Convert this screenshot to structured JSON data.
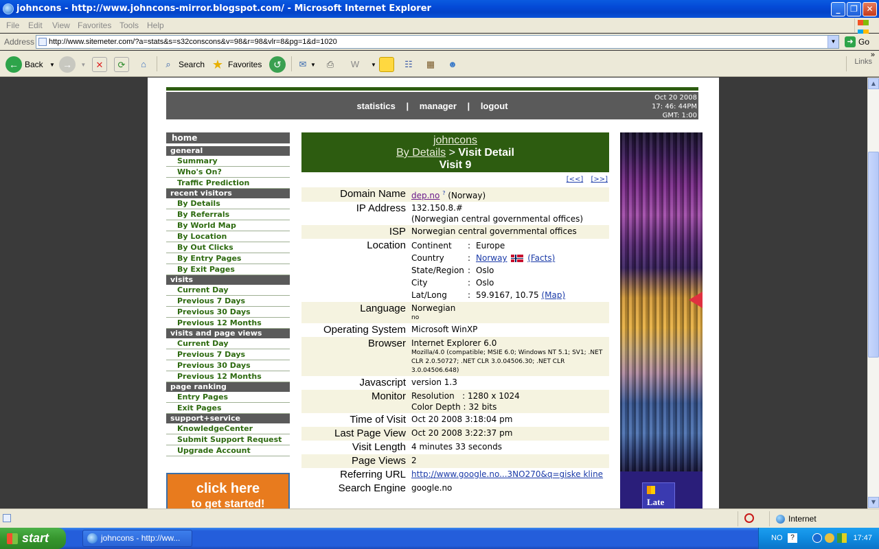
{
  "window": {
    "title": "johncons - http://www.johncons-mirror.blogspot.com/ - Microsoft Internet Explorer"
  },
  "menu": [
    "File",
    "Edit",
    "View",
    "Favorites",
    "Tools",
    "Help"
  ],
  "address": {
    "label": "Address",
    "url": "http://www.sitemeter.com/?a=stats&s=s32conscons&v=98&r=98&vlr=8&pg=1&d=1020",
    "go_label": "Go"
  },
  "toolbar": {
    "back": "Back",
    "search": "Search",
    "favorites": "Favorites",
    "links": "Links"
  },
  "topnav": {
    "statistics": "statistics",
    "manager": "manager",
    "logout": "logout",
    "sep": "|",
    "date": "Oct 20 2008",
    "time": "17: 46: 44PM",
    "gmt": "GMT: 1:00"
  },
  "sidebar": {
    "home": "home",
    "general": {
      "title": "general",
      "items": [
        "Summary",
        "Who's On?",
        "Traffic Prediction"
      ]
    },
    "recent": {
      "title": "recent visitors",
      "items": [
        "By Details",
        "By Referrals",
        "By World Map",
        "By Location",
        "By Out Clicks",
        "By Entry Pages",
        "By Exit Pages"
      ]
    },
    "visits": {
      "title": "visits",
      "items": [
        "Current Day",
        "Previous 7 Days",
        "Previous 30 Days",
        "Previous 12 Months"
      ]
    },
    "visits_pv": {
      "title": "visits and page views",
      "items": [
        "Current Day",
        "Previous 7 Days",
        "Previous 30 Days",
        "Previous 12 Months"
      ]
    },
    "ranking": {
      "title": "page ranking",
      "items": [
        "Entry Pages",
        "Exit Pages"
      ]
    },
    "support": {
      "title": "support+service",
      "items": [
        "KnowledgeCenter",
        "Submit Support Request",
        "Upgrade Account"
      ]
    },
    "promo": {
      "line1": "click here",
      "line2": "to get started!"
    }
  },
  "detail": {
    "site": "johncons",
    "crumb_link": "By Details",
    "crumb_sep": ">",
    "crumb_current": "Visit Detail",
    "visit": "Visit 9",
    "prev": "[<<]",
    "next": "[>>]",
    "domain": {
      "label": "Domain Name",
      "link": "dep.no",
      "sup": "?",
      "country": "(Norway)"
    },
    "ip": {
      "label": "IP Address",
      "value": "132.150.8.#",
      "org": "(Norwegian central governmental offices)"
    },
    "isp": {
      "label": "ISP",
      "value": "Norwegian central governmental offices"
    },
    "location": {
      "label": "Location",
      "continent_k": "Continent",
      "continent_v": "Europe",
      "country_k": "Country",
      "country_v": "Norway",
      "facts": "(Facts)",
      "state_k": "State/Region",
      "state_v": "Oslo",
      "city_k": "City",
      "city_v": "Oslo",
      "latlong_k": "Lat/Long",
      "latlong_v": "59.9167, 10.75",
      "map": "(Map)",
      "colon": ":"
    },
    "language": {
      "label": "Language",
      "value": "Norwegian",
      "code": "no"
    },
    "os": {
      "label": "Operating System",
      "value": "Microsoft WinXP"
    },
    "browser": {
      "label": "Browser",
      "value": "Internet Explorer 6.0",
      "ua": "Mozilla/4.0 (compatible; MSIE 6.0; Windows NT 5.1; SV1; .NET CLR 2.0.50727; .NET CLR 3.0.04506.30; .NET CLR 3.0.04506.648)"
    },
    "javascript": {
      "label": "Javascript",
      "value": "version 1.3"
    },
    "monitor": {
      "label": "Monitor",
      "resolution": "Resolution   : 1280 x 1024",
      "depth": "Color Depth : 32 bits"
    },
    "time_visit": {
      "label": "Time of Visit",
      "value": "Oct 20 2008 3:18:04 pm"
    },
    "last_view": {
      "label": "Last Page View",
      "value": "Oct 20 2008 3:22:37 pm"
    },
    "visit_len": {
      "label": "Visit Length",
      "value": "4 minutes 33 seconds"
    },
    "page_views": {
      "label": "Page Views",
      "value": "2"
    },
    "referring": {
      "label": "Referring URL",
      "value": "http://www.google.no...3NO270&q=giske kline"
    },
    "search_engine": {
      "label": "Search Engine",
      "value": "google.no"
    }
  },
  "ad": {
    "text": "Late"
  },
  "status": {
    "zone": "Internet"
  },
  "taskbar": {
    "start": "start",
    "item": "johncons - http://ww...",
    "lang": "NO",
    "clock": "17:47"
  },
  "colors": {
    "accent_green": "#2d5c10",
    "nav_gray": "#5a5a5a",
    "link_blue": "#1a3aa8"
  }
}
